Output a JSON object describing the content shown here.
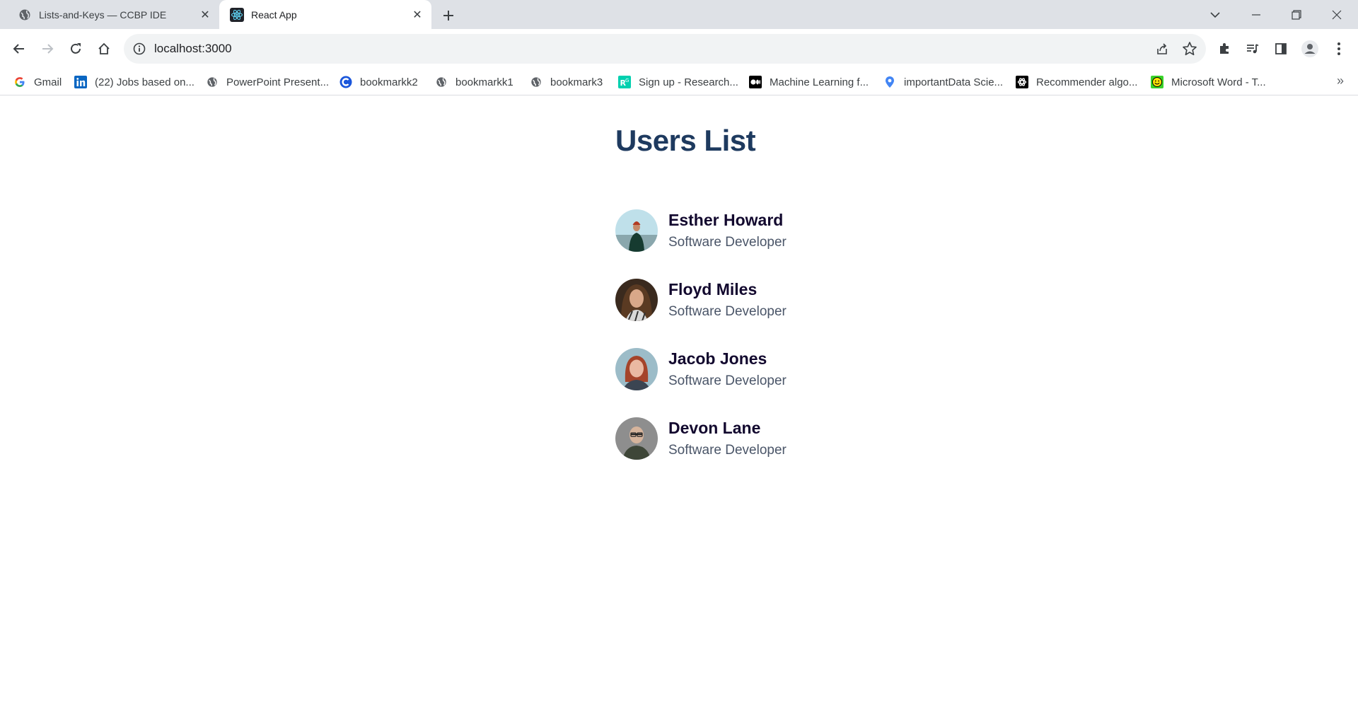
{
  "browser": {
    "tabs": [
      {
        "title": "Lists-and-Keys — CCBP IDE",
        "favicon": "globe-icon",
        "active": false
      },
      {
        "title": "React App",
        "favicon": "react-icon",
        "active": true
      }
    ],
    "address": {
      "url": "localhost:3000"
    },
    "bookmarks": [
      {
        "label": "Gmail",
        "icon": "google-icon"
      },
      {
        "label": "(22) Jobs based on...",
        "icon": "linkedin-icon"
      },
      {
        "label": "PowerPoint Present...",
        "icon": "globe-icon"
      },
      {
        "label": "bookmarkk2",
        "icon": "c-logo-icon"
      },
      {
        "label": "bookmarkk1",
        "icon": "globe-icon"
      },
      {
        "label": "bookmark3",
        "icon": "globe-icon"
      },
      {
        "label": "Sign up - Research...",
        "icon": "researchgate-icon"
      },
      {
        "label": "Machine Learning f...",
        "icon": "medium-icon"
      },
      {
        "label": "importantData Scie...",
        "icon": "location-icon"
      },
      {
        "label": "Recommender algo...",
        "icon": "openai-icon"
      },
      {
        "label": "Microsoft Word - T...",
        "icon": "smiley-icon"
      }
    ]
  },
  "page": {
    "title": "Users List",
    "users": [
      {
        "name": "Esther Howard",
        "role": "Software Developer"
      },
      {
        "name": "Floyd Miles",
        "role": "Software Developer"
      },
      {
        "name": "Jacob Jones",
        "role": "Software Developer"
      },
      {
        "name": "Devon Lane",
        "role": "Software Developer"
      }
    ]
  },
  "colors": {
    "title": "#1e3a5f",
    "name": "#12082e",
    "role": "#4a5568"
  }
}
